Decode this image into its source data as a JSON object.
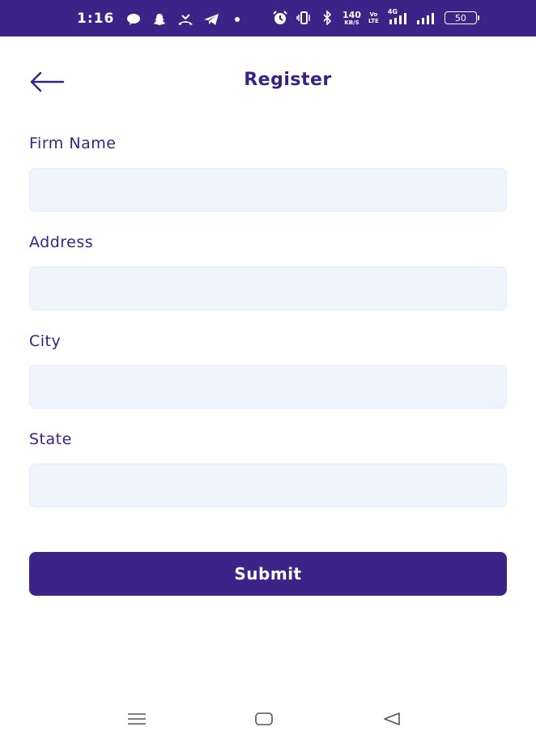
{
  "status_bar": {
    "time": "1:16",
    "net_speed_value": "140",
    "net_speed_unit": "KB/S",
    "volte_top": "Vo",
    "volte_bottom": "LTE",
    "network_type": "4G",
    "battery_level": "50",
    "background_color": "#3d2388"
  },
  "header": {
    "title": "Register",
    "back_icon": "arrow-left-icon"
  },
  "form": {
    "fields": [
      {
        "label": "Firm Name",
        "value": "",
        "placeholder": ""
      },
      {
        "label": "Address",
        "value": "",
        "placeholder": ""
      },
      {
        "label": "City",
        "value": "",
        "placeholder": ""
      },
      {
        "label": "State",
        "value": "",
        "placeholder": ""
      }
    ],
    "submit_label": "Submit",
    "accent_color": "#3d2388",
    "input_background": "#eff5fe"
  },
  "nav_bar": {
    "buttons": [
      "menu-icon",
      "home-icon",
      "back-triangle-icon"
    ]
  }
}
